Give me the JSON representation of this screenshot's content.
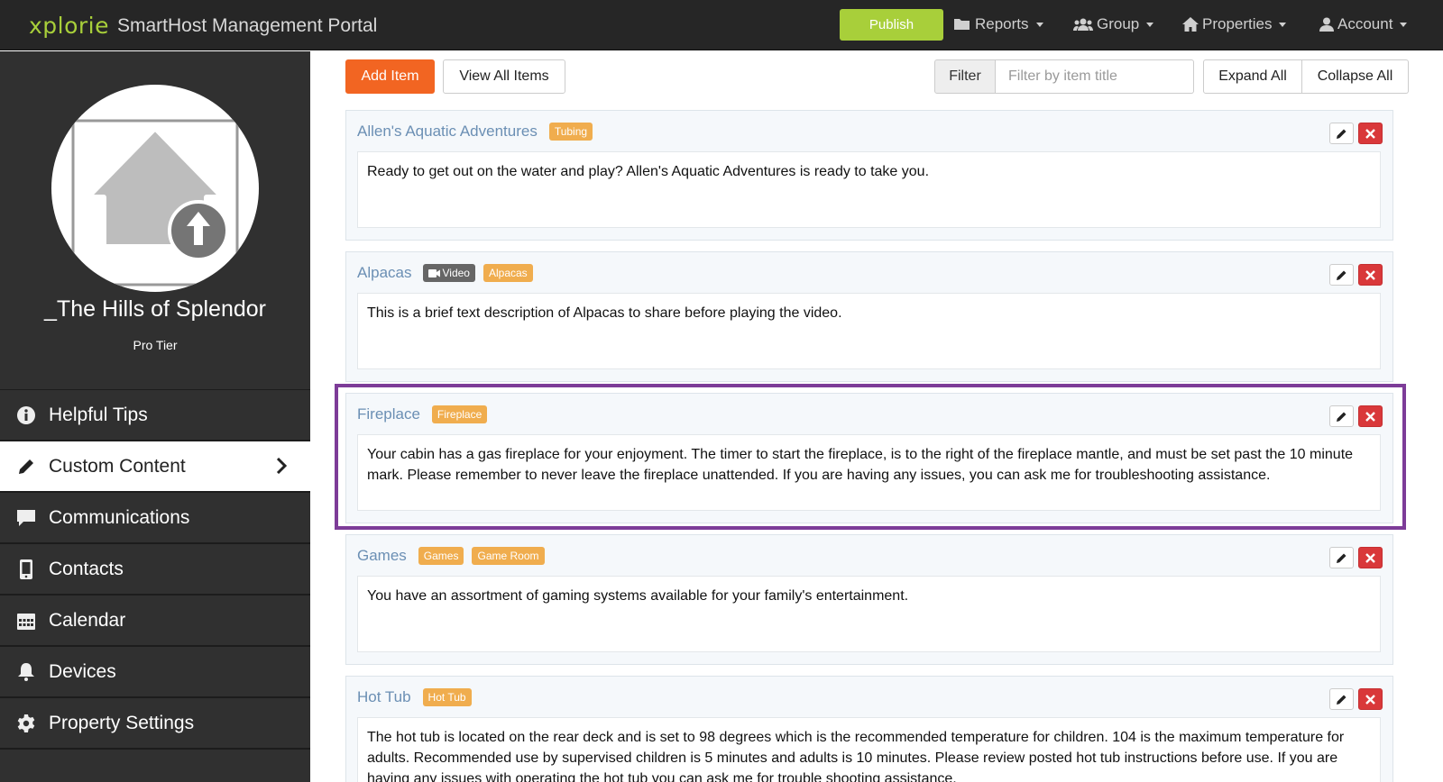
{
  "header": {
    "brand": "xplorie",
    "portal_title": "SmartHost Management Portal",
    "publish_label": "Publish",
    "nav": {
      "reports": "Reports",
      "group": "Group",
      "properties": "Properties",
      "account": "Account"
    }
  },
  "sidebar": {
    "property_name": "_The Hills of Splendor",
    "tier": "Pro Tier",
    "items": [
      {
        "label": "Helpful Tips",
        "icon": "info-icon"
      },
      {
        "label": "Custom Content",
        "icon": "pencil-icon",
        "active": true
      },
      {
        "label": "Communications",
        "icon": "chat-icon"
      },
      {
        "label": "Contacts",
        "icon": "phone-icon"
      },
      {
        "label": "Calendar",
        "icon": "calendar-icon"
      },
      {
        "label": "Devices",
        "icon": "bell-icon"
      },
      {
        "label": "Property Settings",
        "icon": "gear-icon"
      }
    ]
  },
  "toolbar": {
    "add_item": "Add Item",
    "view_all": "View All Items",
    "filter_label": "Filter",
    "filter_placeholder": "Filter by item title",
    "expand_all": "Expand All",
    "collapse_all": "Collapse All"
  },
  "items": [
    {
      "title": "Allen's Aquatic Adventures",
      "tags": [
        "Tubing"
      ],
      "description": "Ready to get out on the water and play? Allen's Aquatic Adventures is ready to take you."
    },
    {
      "title": "Alpacas",
      "video_tag": "Video",
      "tags": [
        "Alpacas"
      ],
      "description": "This is a brief text description of Alpacas to share before playing the video."
    },
    {
      "title": "Fireplace",
      "tags": [
        "Fireplace"
      ],
      "highlighted": true,
      "description": "Your cabin has a gas fireplace for your enjoyment. The timer to start the fireplace, is to the right of the fireplace mantle, and must be set past the 10 minute mark. Please remember to never leave the fireplace unattended. If you are having any issues, you can ask me for troubleshooting assistance."
    },
    {
      "title": "Games",
      "tags": [
        "Games",
        "Game Room"
      ],
      "description": "You have an assortment of gaming systems available for your family's entertainment."
    },
    {
      "title": "Hot Tub",
      "tags": [
        "Hot Tub"
      ],
      "description": "The hot tub is located on the rear deck and is set to 98 degrees which is the recommended temperature for children. 104 is the maximum temperature for adults. Recommended use by supervised children is 5 minutes and adults is 10 minutes. Please review posted hot tub instructions before use. If you are having any issues with operating the hot tub you can ask me for trouble shooting assistance."
    }
  ],
  "colors": {
    "brand_green": "#a8cf3a",
    "accent_orange": "#f26522",
    "tag_orange": "#f0ad4e",
    "delete_red": "#d9383a",
    "highlight_purple": "#7d3c98"
  }
}
